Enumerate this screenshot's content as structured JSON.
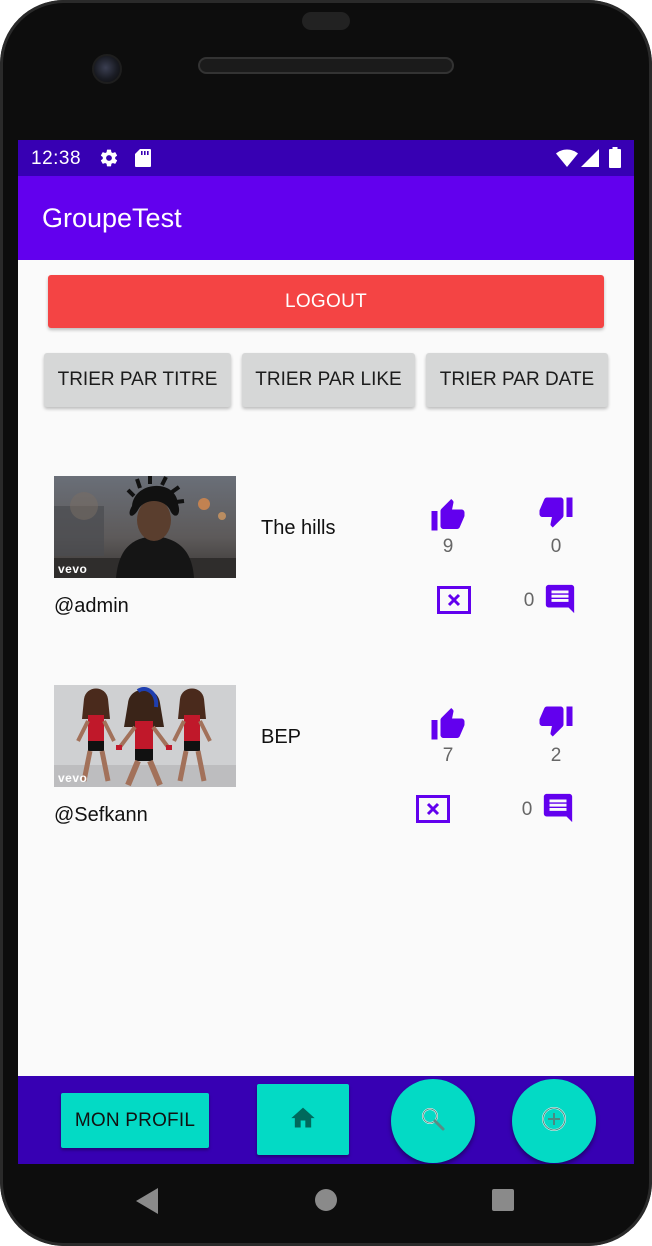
{
  "status_bar": {
    "time": "12:38",
    "icons": [
      "gear-icon",
      "sd-card-icon",
      "wifi-icon",
      "signal-icon",
      "battery-icon"
    ]
  },
  "app_bar": {
    "title": "GroupeTest"
  },
  "actions": {
    "logout_label": "LOGOUT",
    "sort_buttons": [
      "TRIER PAR TITRE",
      "TRIER PAR LIKE",
      "TRIER PAR DATE"
    ]
  },
  "posts": [
    {
      "title": "The hills",
      "user": "@admin",
      "likes": "9",
      "dislikes": "0",
      "comments": "0",
      "thumbnail_watermark": "vevo"
    },
    {
      "title": "BEP",
      "user": "@Sefkann",
      "likes": "7",
      "dislikes": "2",
      "comments": "0",
      "thumbnail_watermark": "vevo"
    }
  ],
  "bottom_nav": {
    "profile_label": "MON PROFIL",
    "icons": [
      "home-icon",
      "search-icon",
      "add-icon"
    ]
  },
  "colors": {
    "status_bar": "#3700b3",
    "app_bar": "#6200ee",
    "logout": "#f44444",
    "accent": "#03dac5",
    "icon_purple": "#6200ee"
  }
}
